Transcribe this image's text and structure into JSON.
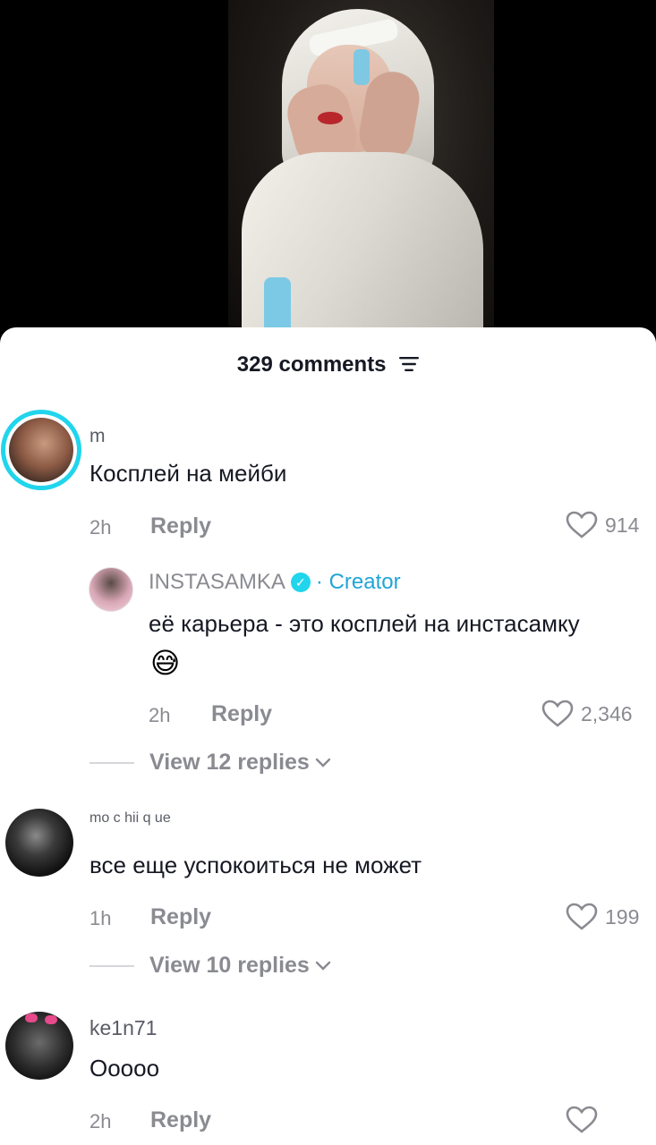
{
  "comments_header": {
    "count_label": "329 comments"
  },
  "comments": [
    {
      "username": "m",
      "text": "Косплей на мейби",
      "time": "2h",
      "reply_label": "Reply",
      "likes": "914",
      "creator_reply": {
        "username": "INSTASAMKA",
        "creator_label": "· Creator",
        "text": "её карьера - это косплей на инстасамку",
        "emoji": "😅",
        "time": "2h",
        "reply_label": "Reply",
        "likes": "2,346"
      },
      "view_replies": "View 12 replies"
    },
    {
      "username": "mo c hii q ue",
      "text": "все еще успокоиться не может",
      "time": "1h",
      "reply_label": "Reply",
      "likes": "199",
      "view_replies": "View 10 replies"
    },
    {
      "username": "ke1n71",
      "text": "Ооооо",
      "time": "2h",
      "reply_label": "Reply",
      "likes": ""
    }
  ],
  "colors": {
    "accent_ring": "#20d5ec",
    "verified": "#20d5ec",
    "creator_tag": "#20a5d6",
    "text_primary": "#161823",
    "text_secondary": "#8a8b91"
  },
  "icons": {
    "filter": "filter-lines-icon",
    "like": "heart-outline-icon",
    "chevron": "chevron-down-icon",
    "verified": "verified-check-icon"
  }
}
